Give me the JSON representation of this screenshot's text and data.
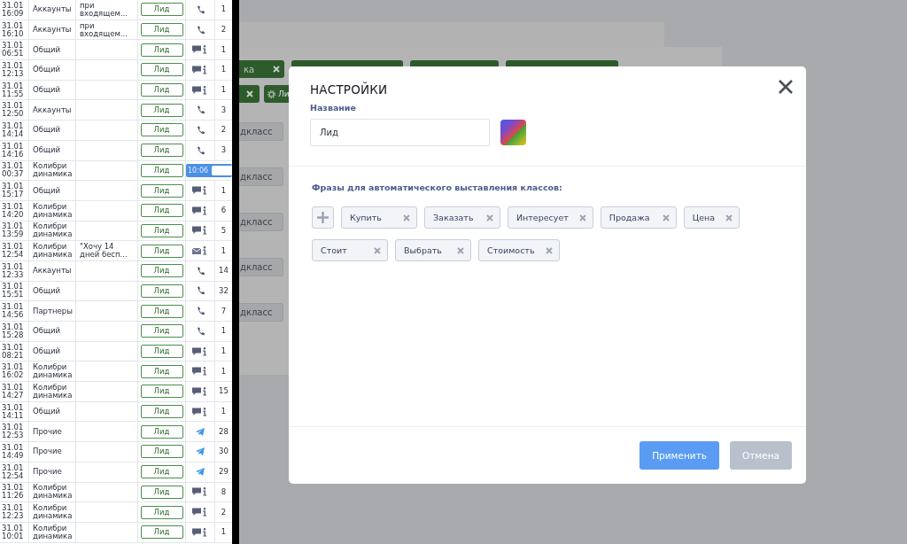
{
  "table": {
    "rows": [
      {
        "datetime": "31.01 16:09",
        "category": "Аккаунты",
        "comment": "при входящем...",
        "class_label": "Лид",
        "kind": "phone",
        "count": "1"
      },
      {
        "datetime": "31.01 16:10",
        "category": "Аккаунты",
        "comment": "при входящем...",
        "class_label": "Лид",
        "kind": "phone",
        "count": "2"
      },
      {
        "datetime": "31.01 06:51",
        "category": "Общий",
        "class_label": "Лид",
        "kind": "chat",
        "count": "1"
      },
      {
        "datetime": "31.01 12:13",
        "category": "Общий",
        "class_label": "Лид",
        "kind": "chat",
        "count": "1"
      },
      {
        "datetime": "31.01 11:55",
        "category": "Общий",
        "class_label": "Лид",
        "kind": "chat",
        "count": "1"
      },
      {
        "datetime": "31.01 12:50",
        "category": "Аккаунты",
        "class_label": "Лид",
        "kind": "phone",
        "count": "3"
      },
      {
        "datetime": "31.01 14:14",
        "category": "Общий",
        "class_label": "Лид",
        "kind": "phone",
        "count": "2"
      },
      {
        "datetime": "31.01 14:16",
        "category": "Общий",
        "class_label": "Лид",
        "kind": "phone",
        "count": "3"
      },
      {
        "datetime": "31.01 00:37",
        "category": "Колибри динамика",
        "class_label": "Лид",
        "kind": "player",
        "player_time": "10:06"
      },
      {
        "datetime": "31.01 15:17",
        "category": "Общий",
        "class_label": "Лид",
        "kind": "chat",
        "count": "1"
      },
      {
        "datetime": "31.01 14:20",
        "category": "Колибри динамика",
        "class_label": "Лид",
        "kind": "chat",
        "count": "6"
      },
      {
        "datetime": "31.01 13:59",
        "category": "Колибри динамика",
        "class_label": "Лид",
        "kind": "chat",
        "count": "5"
      },
      {
        "datetime": "31.01 12:54",
        "category": "Колибри динамика",
        "comment": "\"Хочу 14 дней бесп...",
        "class_label": "Лид",
        "kind": "mail",
        "count": "1"
      },
      {
        "datetime": "31.01 12:33",
        "category": "Аккаунты",
        "class_label": "Лид",
        "kind": "phone",
        "count": "14"
      },
      {
        "datetime": "31.01 15:51",
        "category": "Общий",
        "class_label": "Лид",
        "kind": "phone",
        "count": "32"
      },
      {
        "datetime": "31.01 14:56",
        "category": "Партнеры",
        "class_label": "Лид",
        "kind": "phone",
        "count": "7"
      },
      {
        "datetime": "31.01 15:28",
        "category": "Общий",
        "class_label": "Лид",
        "kind": "phone",
        "count": "1"
      },
      {
        "datetime": "31.01 08:21",
        "category": "Общий",
        "class_label": "Лид",
        "kind": "chat",
        "count": "1"
      },
      {
        "datetime": "31.01 16:02",
        "category": "Колибри динамика",
        "class_label": "Лид",
        "kind": "chat",
        "count": "1"
      },
      {
        "datetime": "31.01 14:27",
        "category": "Колибри динамика",
        "class_label": "Лид",
        "kind": "chat",
        "count": "15"
      },
      {
        "datetime": "31.01 14:11",
        "category": "Общий",
        "class_label": "Лид",
        "kind": "chat",
        "count": "1"
      },
      {
        "datetime": "31.01 12:53",
        "category": "Прочие",
        "class_label": "Лид",
        "kind": "telegram",
        "count": "28"
      },
      {
        "datetime": "31.01 14:49",
        "category": "Прочие",
        "class_label": "Лид",
        "kind": "telegram",
        "count": "30"
      },
      {
        "datetime": "31.01 12:54",
        "category": "Прочие",
        "class_label": "Лид",
        "kind": "telegram",
        "count": "29"
      },
      {
        "datetime": "31.01 11:26",
        "category": "Колибри динамика",
        "class_label": "Лид",
        "kind": "chat",
        "count": "8"
      },
      {
        "datetime": "31.01 12:23",
        "category": "Колибри динамика",
        "class_label": "Лид",
        "kind": "chat",
        "count": "2"
      },
      {
        "datetime": "31.01 10:01",
        "category": "Колибри динамика",
        "class_label": "Лид",
        "kind": "chat",
        "count": "1"
      }
    ]
  },
  "background": {
    "chips_row_1": [
      {
        "label": "ка"
      }
    ],
    "chips_row_2": [
      {
        "kind": "remove"
      },
      {
        "kind": "settings",
        "label": "Ли"
      }
    ],
    "subclass_buttons": [
      "дкласс",
      "дкласс",
      "дкласс",
      "дкласс",
      "дкласс"
    ]
  },
  "modal": {
    "title": "НАСТРОЙКИ",
    "name_label": "Название",
    "name_value": "Лид",
    "phrases_label": "Фразы для автоматического выставления классов:",
    "phrases": [
      "Купить",
      "Заказать",
      "Интересует",
      "Продажа",
      "Цена",
      "Стоит",
      "Выбрать",
      "Стоимость"
    ],
    "buttons": [
      {
        "label": "Применить",
        "kind": "primary",
        "disabled": false
      },
      {
        "label": "Отмена",
        "kind": "secondary",
        "disabled": true
      }
    ]
  }
}
